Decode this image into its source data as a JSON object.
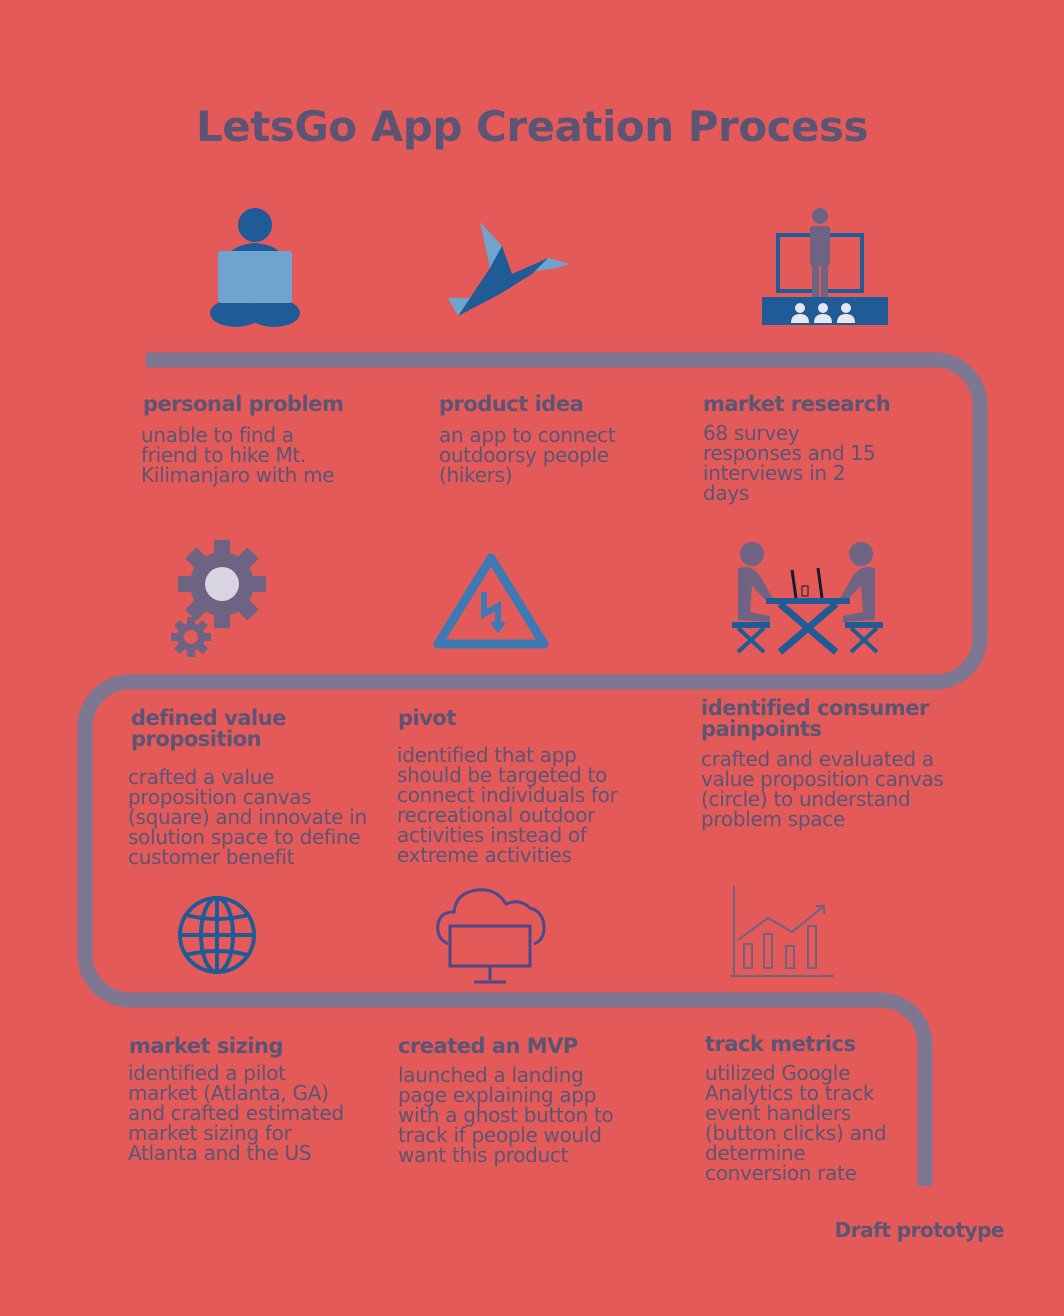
{
  "title": "LetsGo App Creation Process",
  "footer": "Draft prototype",
  "colors": {
    "background": "#E35A58",
    "text": "#5C5475",
    "path": "#7E7792",
    "dark_blue": "#1F5B96",
    "light_blue": "#6FA4CF",
    "purple": "#6E6382"
  },
  "steps": [
    {
      "title": "personal problem",
      "description": "unable to find a friend to hike Mt. Kilimanjaro with me",
      "icon": "person-laptop-icon"
    },
    {
      "title": "product idea",
      "description": "an app to connect outdoorsy people (hikers)",
      "icon": "origami-bird-icon"
    },
    {
      "title": "market research",
      "description": "68 survey responses and 15 interviews in 2 days",
      "icon": "presenter-audience-icon"
    },
    {
      "title": "defined value proposition",
      "description": "crafted a value proposition canvas (square) and innovate in solution space to define customer benefit",
      "icon": "gears-icon"
    },
    {
      "title": "pivot",
      "description": "identified that app should be targeted to connect individuals for recreational outdoor activities instead of extreme activities",
      "icon": "warning-triangle-icon"
    },
    {
      "title": "identified consumer painpoints",
      "description": "crafted and evaluated a value proposition canvas (circle) to understand problem space",
      "icon": "interview-table-icon"
    },
    {
      "title": "market sizing",
      "description": "identified a pilot market (Atlanta, GA) and crafted estimated market sizing for Atlanta and the US",
      "icon": "globe-icon"
    },
    {
      "title": "created an MVP",
      "description": "launched a landing page explaining app with a ghost button to track if people would want this product",
      "icon": "cloud-monitor-icon"
    },
    {
      "title": "track metrics",
      "description": "utilized Google Analytics to track event handlers (button clicks) and determine conversion rate",
      "icon": "bar-chart-icon"
    }
  ]
}
